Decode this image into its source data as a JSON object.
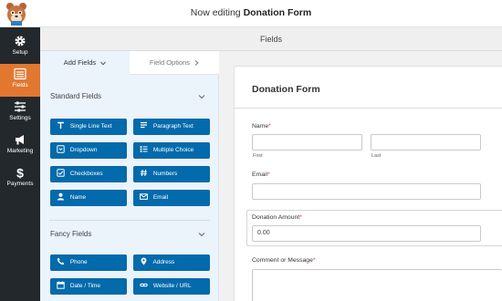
{
  "header": {
    "prefix": "Now editing",
    "form_name": "Donation Form",
    "logo": "wpforms-bear-logo"
  },
  "sidebar": {
    "items": [
      {
        "label": "Setup",
        "icon": "gear-icon"
      },
      {
        "label": "Fields",
        "icon": "fields-icon",
        "active": true
      },
      {
        "label": "Settings",
        "icon": "sliders-icon"
      },
      {
        "label": "Marketing",
        "icon": "megaphone-icon"
      },
      {
        "label": "Payments",
        "icon": "dollar-icon"
      }
    ]
  },
  "fields_bar": {
    "title": "Fields"
  },
  "panel": {
    "tabs": {
      "add": "Add Fields",
      "options": "Field Options"
    },
    "standard": {
      "title": "Standard Fields",
      "buttons": [
        {
          "label": "Single Line Text",
          "icon": "text-icon"
        },
        {
          "label": "Paragraph Text",
          "icon": "paragraph-icon"
        },
        {
          "label": "Dropdown",
          "icon": "dropdown-icon"
        },
        {
          "label": "Multiple Choice",
          "icon": "list-icon"
        },
        {
          "label": "Checkboxes",
          "icon": "checkbox-icon"
        },
        {
          "label": "Numbers",
          "icon": "hash-icon"
        },
        {
          "label": "Name",
          "icon": "user-icon"
        },
        {
          "label": "Email",
          "icon": "envelope-icon"
        }
      ]
    },
    "fancy": {
      "title": "Fancy Fields",
      "buttons": [
        {
          "label": "Phone",
          "icon": "phone-icon"
        },
        {
          "label": "Address",
          "icon": "map-pin-icon"
        },
        {
          "label": "Date / Time",
          "icon": "calendar-icon"
        },
        {
          "label": "Website / URL",
          "icon": "link-icon"
        }
      ]
    }
  },
  "form": {
    "title": "Donation Form",
    "name": {
      "label": "Name",
      "required": "*",
      "first": "First",
      "last": "Last"
    },
    "email": {
      "label": "Email",
      "required": "*"
    },
    "amount": {
      "label": "Donation Amount",
      "required": "*",
      "value": "0.00"
    },
    "comment": {
      "label": "Comment or Message",
      "required": "*"
    }
  },
  "colors": {
    "accent": "#e27730",
    "sidebar": "#23282d",
    "button": "#036aab",
    "panel": "#ebf3fb"
  }
}
